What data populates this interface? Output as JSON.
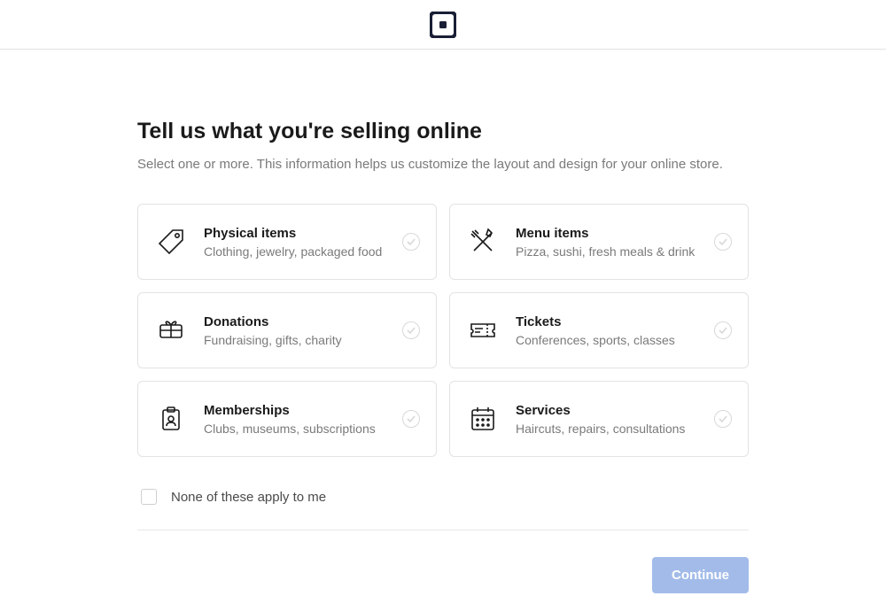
{
  "heading": "Tell us what you're selling online",
  "subheading": "Select one or more. This information helps us customize the layout and design for your online store.",
  "options": [
    {
      "title": "Physical items",
      "desc": "Clothing, jewelry, packaged food"
    },
    {
      "title": "Menu items",
      "desc": "Pizza, sushi, fresh meals & drink"
    },
    {
      "title": "Donations",
      "desc": "Fundraising, gifts, charity"
    },
    {
      "title": "Tickets",
      "desc": "Conferences, sports, classes"
    },
    {
      "title": "Memberships",
      "desc": "Clubs, museums, subscriptions"
    },
    {
      "title": "Services",
      "desc": "Haircuts, repairs, consultations"
    }
  ],
  "none_label": "None of these apply to me",
  "continue_label": "Continue"
}
